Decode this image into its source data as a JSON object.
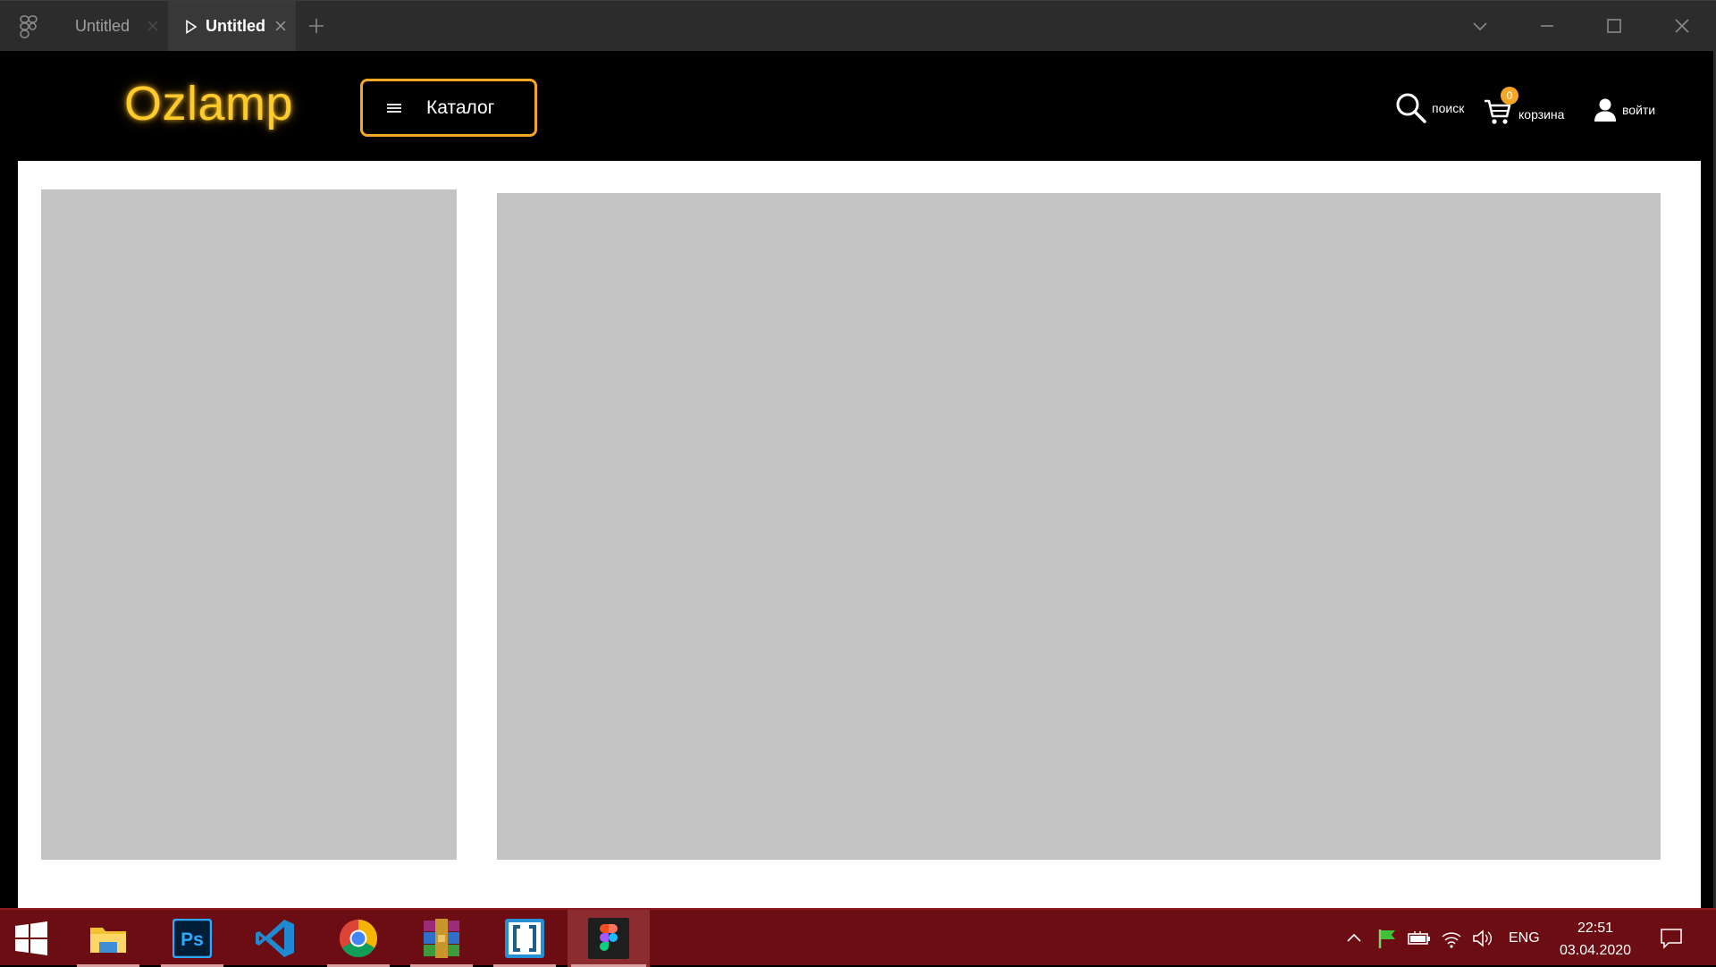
{
  "window": {
    "tabs": [
      {
        "label": "Untitled",
        "active": false
      },
      {
        "label": "Untitled",
        "active": true
      }
    ]
  },
  "site": {
    "logo": "Ozlamp",
    "catalog_label": "Каталог",
    "search_label": "поиск",
    "cart_label": "корзина",
    "cart_count": "0",
    "login_label": "войти",
    "accent_color": "#f5a623",
    "logo_color": "#ffca2c",
    "placeholder_color": "#c4c4c4"
  },
  "taskbar": {
    "apps": [
      "file-explorer",
      "photoshop",
      "vscode",
      "chrome",
      "winrar",
      "brackets",
      "figma"
    ],
    "language": "ENG",
    "time": "22:51",
    "date": "03.04.2020",
    "background": "#6b0d12"
  }
}
